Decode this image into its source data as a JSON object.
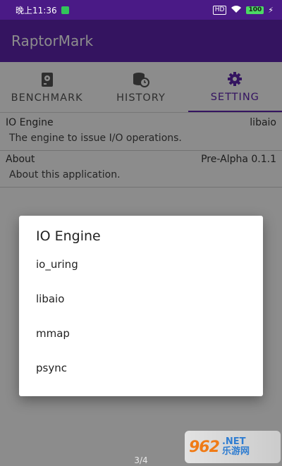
{
  "status_bar": {
    "time": "晚上11:36",
    "sim": "HD",
    "battery": "100"
  },
  "app": {
    "title": "RaptorMark"
  },
  "tabs": [
    {
      "label": "BENCHMARK",
      "icon": "hard-drive-icon",
      "active": false
    },
    {
      "label": "HISTORY",
      "icon": "database-clock-icon",
      "active": false
    },
    {
      "label": "SETTING",
      "icon": "gear-icon",
      "active": true
    }
  ],
  "settings": [
    {
      "title": "IO Engine",
      "value": "libaio",
      "description": "The engine to issue I/O operations."
    },
    {
      "title": "About",
      "value": "Pre-Alpha 0.1.1",
      "description": "About this application."
    }
  ],
  "dialog": {
    "title": "IO Engine",
    "options": [
      "io_uring",
      "libaio",
      "mmap",
      "psync"
    ]
  },
  "page_indicator": "3/4",
  "watermark": {
    "logo": "962",
    "net": ".NET",
    "subtitle": "乐游网"
  },
  "colors": {
    "primary": "#6026b0",
    "statusbar": "#4a1a86"
  }
}
